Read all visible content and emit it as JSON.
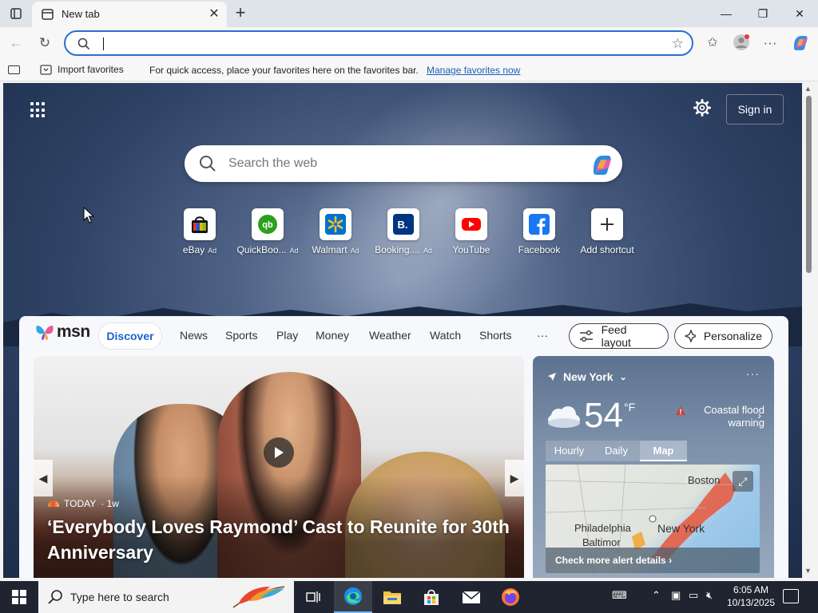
{
  "tab": {
    "title": "New tab",
    "close": "✕"
  },
  "addressbar": {
    "value": "",
    "placeholder": ""
  },
  "favorites_bar": {
    "import_label": "Import favorites",
    "hint": "For quick access, place your favorites here on the favorites bar.",
    "manage_link": "Manage favorites now"
  },
  "header": {
    "sign_in": "Sign in"
  },
  "web_search": {
    "placeholder": "Search the web"
  },
  "shortcuts": [
    {
      "label": "eBay",
      "ad": "Ad",
      "icon": "ebay-icon"
    },
    {
      "label": "QuickBoo...",
      "ad": "Ad",
      "icon": "quickbooks-icon"
    },
    {
      "label": "Walmart",
      "ad": "Ad",
      "icon": "walmart-icon"
    },
    {
      "label": "Booking....",
      "ad": "Ad",
      "icon": "booking-icon"
    },
    {
      "label": "YouTube",
      "ad": "",
      "icon": "youtube-icon"
    },
    {
      "label": "Facebook",
      "ad": "",
      "icon": "facebook-icon"
    },
    {
      "label": "Add shortcut",
      "ad": "",
      "icon": "plus-icon"
    }
  ],
  "msn": {
    "logo": "msn",
    "tabs": [
      "Discover",
      "News",
      "Sports",
      "Play",
      "Money",
      "Weather",
      "Watch",
      "Shorts"
    ],
    "more": "···",
    "feed_layout": "Feed layout",
    "personalize": "Personalize"
  },
  "hero": {
    "source": "TODAY",
    "age": "· 1w",
    "headline": "‘Everybody Loves Raymond’ Cast to Reunite for 30th Anniversary"
  },
  "weather": {
    "location": "New York",
    "temperature": "54",
    "unit": "°F",
    "alert": "Coastal flood warning",
    "tabs": [
      "Hourly",
      "Daily",
      "Map"
    ],
    "map_labels": [
      "Boston",
      "Philadelphia",
      "New York",
      "Baltimor"
    ],
    "alert_link": "Check more alert details"
  },
  "taskbar": {
    "search_placeholder": "Type here to search",
    "time": "6:05 AM",
    "date": "10/13/2025"
  },
  "colors": {
    "accent": "#2b6fcf",
    "msn_active": "#1a63c9",
    "taskbar": "#1f2430"
  }
}
